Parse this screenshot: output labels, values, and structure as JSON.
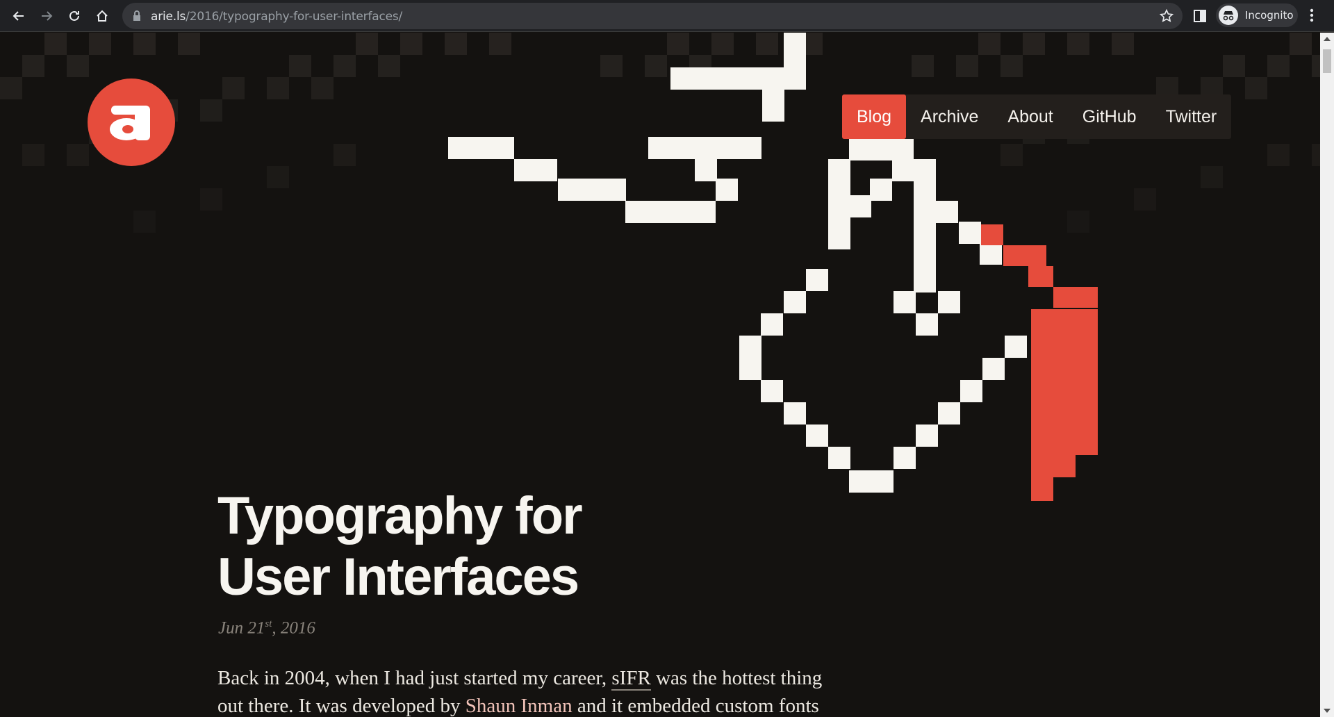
{
  "browser": {
    "url_host": "arie.ls",
    "url_path": "/2016/typography-for-user-interfaces/",
    "profile_label": "Incognito"
  },
  "site": {
    "nav": [
      {
        "label": "Blog",
        "active": true
      },
      {
        "label": "Archive",
        "active": false
      },
      {
        "label": "About",
        "active": false
      },
      {
        "label": "GitHub",
        "active": false
      },
      {
        "label": "Twitter",
        "active": false
      }
    ],
    "accent_color": "#e64c3c",
    "background_color": "#141210"
  },
  "article": {
    "title_line1": "Typography for",
    "title_line2": "User Interfaces",
    "date_month_day": "Jun 21",
    "date_suffix": "st",
    "date_year": ", 2016",
    "intro": {
      "t1": "Back in 2004, when I had just started my career, ",
      "link1": "sIFR",
      "t2": " was the hottest thing out there. It was developed by ",
      "link2": "Shaun Inman",
      "t3": " and it embedded custom fonts"
    }
  }
}
